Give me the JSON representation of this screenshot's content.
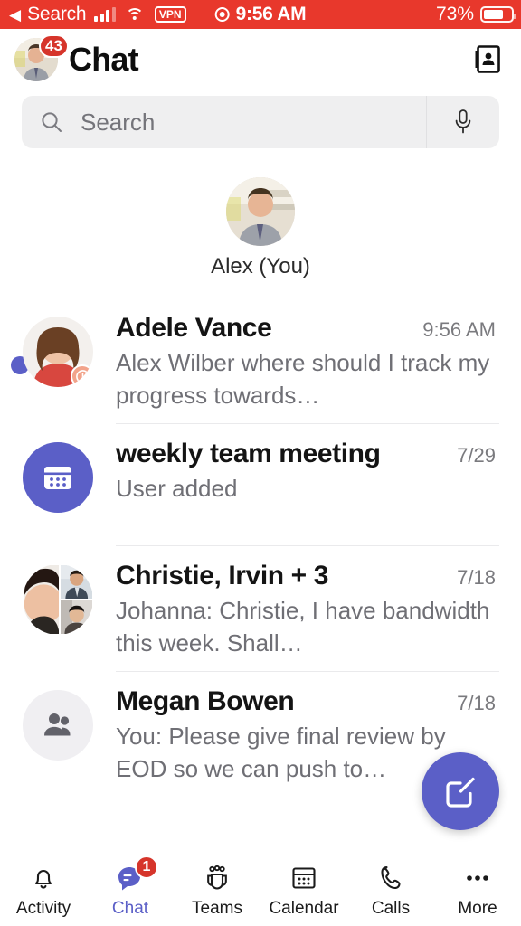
{
  "status_bar": {
    "back_arrow": "◀",
    "carrier_label": "Search",
    "vpn_label": "VPN",
    "recording_icon": "record-indicator-icon",
    "time": "9:56 AM",
    "battery_percent": "73%",
    "battery_level": 73,
    "background_color": "#E8382C",
    "foreground_color": "#FFFFFF"
  },
  "header": {
    "title": "Chat",
    "avatar_badge_count": "43",
    "avatar_name": "avatar",
    "right_action_icon": "contacts-book-icon"
  },
  "search": {
    "placeholder": "Search",
    "value": "",
    "search_icon": "search-icon",
    "mic_icon": "microphone-icon"
  },
  "self_profile": {
    "name": "Alex (You)"
  },
  "chat_list": [
    {
      "name": "Adele Vance",
      "preview": "Alex Wilber where should I track my progress towards…",
      "time": "9:56 AM",
      "unread": true,
      "avatar_type": "photo-woman",
      "presence": "away",
      "presence_icon": "clock-icon"
    },
    {
      "name": "weekly team meeting",
      "preview": "User added",
      "time": "7/29",
      "unread": false,
      "avatar_type": "calendar",
      "avatar_icon": "calendar-icon",
      "avatar_color": "#5B5FC7"
    },
    {
      "name": "Christie, Irvin + 3",
      "preview": "Johanna: Christie, I have bandwidth this week. Shall…",
      "time": "7/18",
      "unread": false,
      "avatar_type": "mosaic-3"
    },
    {
      "name": "Megan Bowen",
      "preview": "You: Please give final review by EOD so we can push to…",
      "time": "7/18",
      "unread": false,
      "avatar_type": "group-generic",
      "avatar_icon": "people-icon"
    }
  ],
  "fab": {
    "icon": "compose-icon",
    "color": "#5B5FC7"
  },
  "bottom_nav": {
    "active_color": "#5B5FC7",
    "items": [
      {
        "label": "Activity",
        "icon": "bell-icon",
        "active": false,
        "badge": ""
      },
      {
        "label": "Chat",
        "icon": "chat-bubble-icon",
        "active": true,
        "badge": "1"
      },
      {
        "label": "Teams",
        "icon": "teams-people-icon",
        "active": false,
        "badge": ""
      },
      {
        "label": "Calendar",
        "icon": "calendar-icon",
        "active": false,
        "badge": ""
      },
      {
        "label": "Calls",
        "icon": "phone-icon",
        "active": false,
        "badge": ""
      },
      {
        "label": "More",
        "icon": "ellipsis-icon",
        "active": false,
        "badge": ""
      }
    ]
  }
}
